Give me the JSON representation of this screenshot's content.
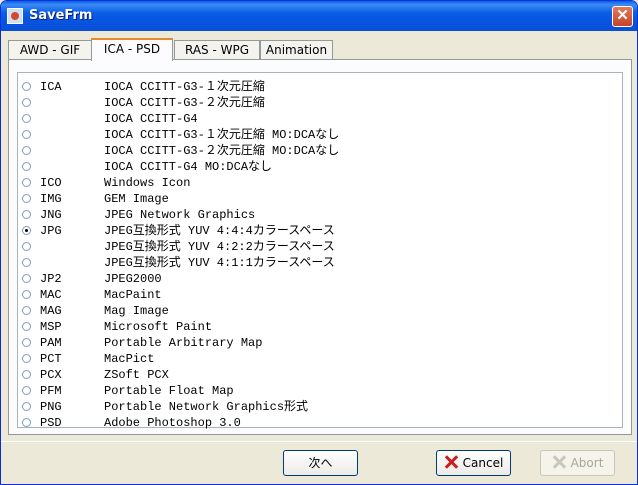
{
  "window": {
    "title": "SaveFrm"
  },
  "tabs": [
    {
      "label": "AWD - GIF"
    },
    {
      "label": "ICA - PSD"
    },
    {
      "label": "RAS - WPG"
    },
    {
      "label": "Animation"
    }
  ],
  "formats": [
    {
      "code": "ICA",
      "desc": "IOCA CCITT-G3-１次元圧縮",
      "checked": false
    },
    {
      "code": "",
      "desc": "IOCA CCITT-G3-２次元圧縮",
      "checked": false
    },
    {
      "code": "",
      "desc": "IOCA CCITT-G4",
      "checked": false
    },
    {
      "code": "",
      "desc": "IOCA CCITT-G3-１次元圧縮 MO:DCAなし",
      "checked": false
    },
    {
      "code": "",
      "desc": "IOCA CCITT-G3-２次元圧縮 MO:DCAなし",
      "checked": false
    },
    {
      "code": "",
      "desc": "IOCA CCITT-G4 MO:DCAなし",
      "checked": false
    },
    {
      "code": "ICO",
      "desc": "Windows Icon",
      "checked": false
    },
    {
      "code": "IMG",
      "desc": "GEM Image",
      "checked": false
    },
    {
      "code": "JNG",
      "desc": "JPEG Network Graphics",
      "checked": false
    },
    {
      "code": "JPG",
      "desc": "JPEG互換形式 YUV 4:4:4カラースペース",
      "checked": true
    },
    {
      "code": "",
      "desc": "JPEG互換形式 YUV 4:2:2カラースペース",
      "checked": false
    },
    {
      "code": "",
      "desc": "JPEG互換形式 YUV 4:1:1カラースペース",
      "checked": false
    },
    {
      "code": "JP2",
      "desc": "JPEG2000",
      "checked": false
    },
    {
      "code": "MAC",
      "desc": "MacPaint",
      "checked": false
    },
    {
      "code": "MAG",
      "desc": "Mag Image",
      "checked": false
    },
    {
      "code": "MSP",
      "desc": "Microsoft Paint",
      "checked": false
    },
    {
      "code": "PAM",
      "desc": "Portable Arbitrary Map",
      "checked": false
    },
    {
      "code": "PCT",
      "desc": "MacPict",
      "checked": false
    },
    {
      "code": "PCX",
      "desc": "ZSoft PCX",
      "checked": false
    },
    {
      "code": "PFM",
      "desc": "Portable Float Map",
      "checked": false
    },
    {
      "code": "PNG",
      "desc": "Portable Network Graphics形式",
      "checked": false
    },
    {
      "code": "PSD",
      "desc": "Adobe Photoshop 3.0",
      "checked": false
    }
  ],
  "buttons": {
    "next": "次へ",
    "cancel": "Cancel",
    "abort": "Abort"
  }
}
